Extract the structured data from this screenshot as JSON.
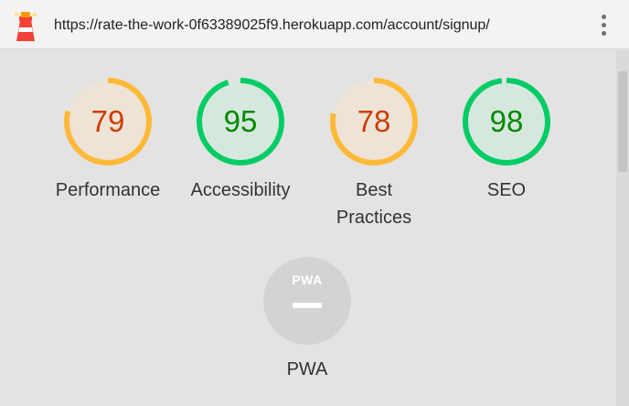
{
  "topbar": {
    "url": "https://rate-the-work-0f63389025f9.herokuapp.com/account/signup/",
    "logo_icon": "lighthouse-icon",
    "menu_icon": "kebab-menu-icon"
  },
  "gauges": [
    {
      "label": "Performance",
      "score": "79",
      "value": 0.79,
      "status": "average"
    },
    {
      "label": "Accessibility",
      "score": "95",
      "value": 0.95,
      "status": "pass"
    },
    {
      "label": "Best\nPractices",
      "score": "78",
      "value": 0.78,
      "status": "average"
    },
    {
      "label": "SEO",
      "score": "98",
      "value": 0.98,
      "status": "pass"
    }
  ],
  "pwa": {
    "label": "PWA",
    "badge": "PWA",
    "icon": "pwa-badge-icon"
  },
  "colors": {
    "average_arc": "#ffb938",
    "average_fill": "#ede3d6",
    "average_text": "#cc3d00",
    "pass_arc": "#00cc66",
    "pass_fill": "#d6e8de",
    "pass_text": "#008a00",
    "pwa_circle": "#d3d3d3"
  }
}
